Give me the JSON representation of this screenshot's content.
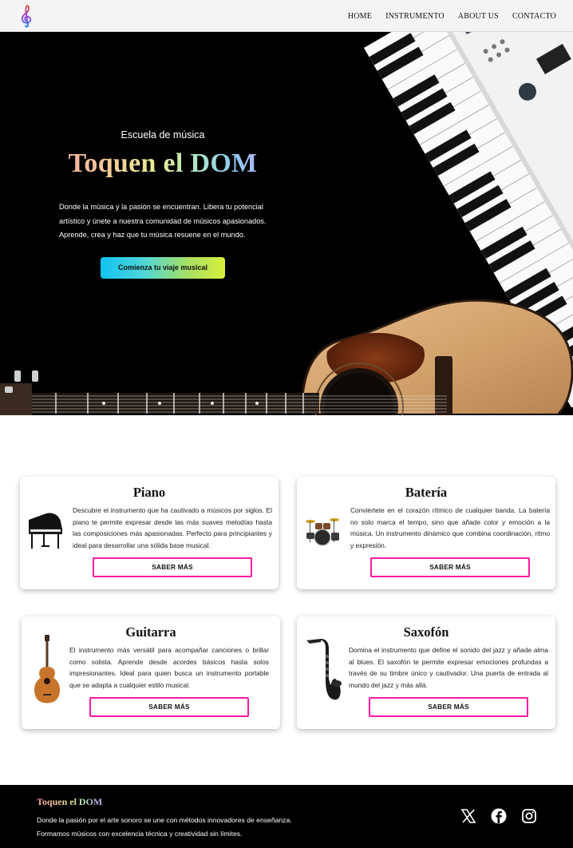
{
  "nav": {
    "items": [
      {
        "label": "HOME"
      },
      {
        "label": "INSTRUMENTO"
      },
      {
        "label": "ABOUT US"
      },
      {
        "label": "CONTACTO"
      }
    ]
  },
  "hero": {
    "subtitle": "Escuela de música",
    "title": "Toquen el DOM",
    "description": "Donde la música y la pasión se encuentran. Libera tu potencial artístico y únete a nuestra comunidad de músicos apasionados. Aprende, crea y haz que tu música resuene en el mundo.",
    "cta_label": "Comienza tu viaje musical"
  },
  "cards": [
    {
      "title": "Piano",
      "icon": "grand-piano-icon",
      "text": "Descubre el instrumento que ha cautivado a músicos por siglos. El piano te permite expresar desde las más suaves melodías hasta las composiciones más apasionadas. Perfecto para principiantes y ideal para desarrollar una sólida base musical.",
      "button": "SABER MÁS"
    },
    {
      "title": "Batería",
      "icon": "drum-kit-icon",
      "text": "Conviértete en el corazón rítmico de cualquier banda. La batería no solo marca el tempo, sino que añade color y emoción a la música. Un instrumento dinámico que combina coordinación, ritmo y expresión.",
      "button": "SABER MÁS"
    },
    {
      "title": "Guitarra",
      "icon": "guitar-icon",
      "text": "El instrumento más versátil para acompañar canciones o brillar como solista. Aprende desde acordes básicos hasta solos impresionantes. Ideal para quien busca un instrumento portable que se adapta a cualquier estilo musical.",
      "button": "SABER MÁS"
    },
    {
      "title": "Saxofón",
      "icon": "saxophone-icon",
      "text": "Domina el instrumento que define el sonido del jazz y añade alma al blues. El saxofón te permite expresar emociones profundas a través de su timbre único y cautivador. Una puerta de entrada al mundo del jazz y más allá.",
      "button": "SABER MÁS"
    }
  ],
  "footer": {
    "brand": "Toquen el DOM",
    "line1": "Donde la pasión por el arte sonoro se une con métodos innovadores de enseñanza.",
    "line2": "Formamos músicos con excelencia técnica y creatividad sin límites.",
    "social": [
      "x-icon",
      "facebook-icon",
      "instagram-icon"
    ]
  },
  "colors": {
    "accent_pink": "#ff1aa3",
    "cta_gradient_start": "#12c2f0",
    "cta_gradient_end": "#d8ee3a"
  }
}
